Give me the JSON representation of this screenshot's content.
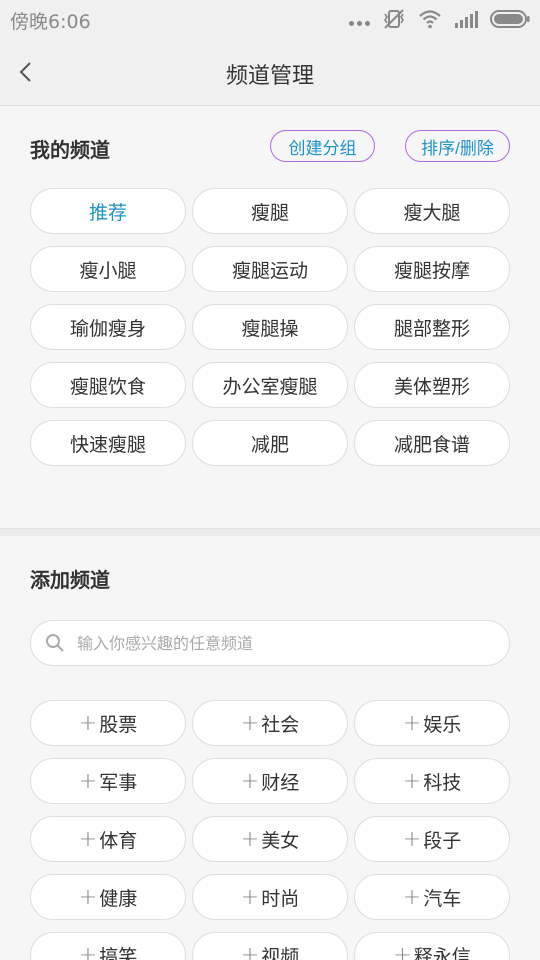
{
  "status": {
    "time": "傍晚6:06"
  },
  "header": {
    "title": "频道管理"
  },
  "my_channels": {
    "title": "我的频道",
    "create_group_label": "创建分组",
    "sort_delete_label": "排序/删除",
    "items": [
      {
        "label": "推荐",
        "active": true
      },
      {
        "label": "瘦腿"
      },
      {
        "label": "瘦大腿"
      },
      {
        "label": "瘦小腿"
      },
      {
        "label": "瘦腿运动"
      },
      {
        "label": "瘦腿按摩"
      },
      {
        "label": "瑜伽瘦身"
      },
      {
        "label": "瘦腿操"
      },
      {
        "label": "腿部整形"
      },
      {
        "label": "瘦腿饮食"
      },
      {
        "label": "办公室瘦腿"
      },
      {
        "label": "美体塑形"
      },
      {
        "label": "快速瘦腿"
      },
      {
        "label": "减肥"
      },
      {
        "label": "减肥食谱"
      }
    ]
  },
  "add_channels": {
    "title": "添加频道",
    "search_placeholder": "输入你感兴趣的任意频道",
    "add_symbol": "+",
    "items": [
      {
        "label": "股票"
      },
      {
        "label": "社会"
      },
      {
        "label": "娱乐"
      },
      {
        "label": "军事"
      },
      {
        "label": "财经"
      },
      {
        "label": "科技"
      },
      {
        "label": "体育"
      },
      {
        "label": "美女"
      },
      {
        "label": "段子"
      },
      {
        "label": "健康"
      },
      {
        "label": "时尚"
      },
      {
        "label": "汽车"
      },
      {
        "label": "搞笑"
      },
      {
        "label": "视频"
      },
      {
        "label": "释永信"
      }
    ]
  },
  "colors": {
    "accent": "#1e93c8",
    "outline": "#b06ad9"
  }
}
